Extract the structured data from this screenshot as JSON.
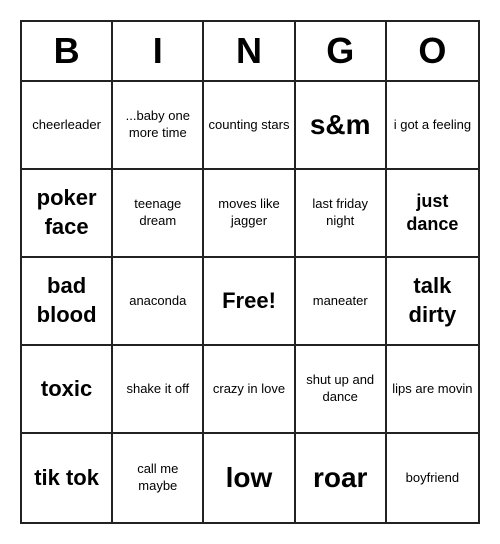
{
  "header": {
    "letters": [
      "B",
      "I",
      "N",
      "G",
      "O"
    ]
  },
  "cells": [
    {
      "text": "cheerleader",
      "size": "small"
    },
    {
      "text": "...baby one more time",
      "size": "small"
    },
    {
      "text": "counting stars",
      "size": "small"
    },
    {
      "text": "s&m",
      "size": "xlarge"
    },
    {
      "text": "i got a feeling",
      "size": "small"
    },
    {
      "text": "poker face",
      "size": "large"
    },
    {
      "text": "teenage dream",
      "size": "small"
    },
    {
      "text": "moves like jagger",
      "size": "small"
    },
    {
      "text": "last friday night",
      "size": "small"
    },
    {
      "text": "just dance",
      "size": "medium"
    },
    {
      "text": "bad blood",
      "size": "large"
    },
    {
      "text": "anaconda",
      "size": "small"
    },
    {
      "text": "Free!",
      "size": "free"
    },
    {
      "text": "maneater",
      "size": "small"
    },
    {
      "text": "talk dirty",
      "size": "large"
    },
    {
      "text": "toxic",
      "size": "large"
    },
    {
      "text": "shake it off",
      "size": "small"
    },
    {
      "text": "crazy in love",
      "size": "small"
    },
    {
      "text": "shut up and dance",
      "size": "small"
    },
    {
      "text": "lips are movin",
      "size": "small"
    },
    {
      "text": "tik tok",
      "size": "large"
    },
    {
      "text": "call me maybe",
      "size": "small"
    },
    {
      "text": "low",
      "size": "xlarge"
    },
    {
      "text": "roar",
      "size": "xlarge"
    },
    {
      "text": "boyfriend",
      "size": "small"
    }
  ]
}
